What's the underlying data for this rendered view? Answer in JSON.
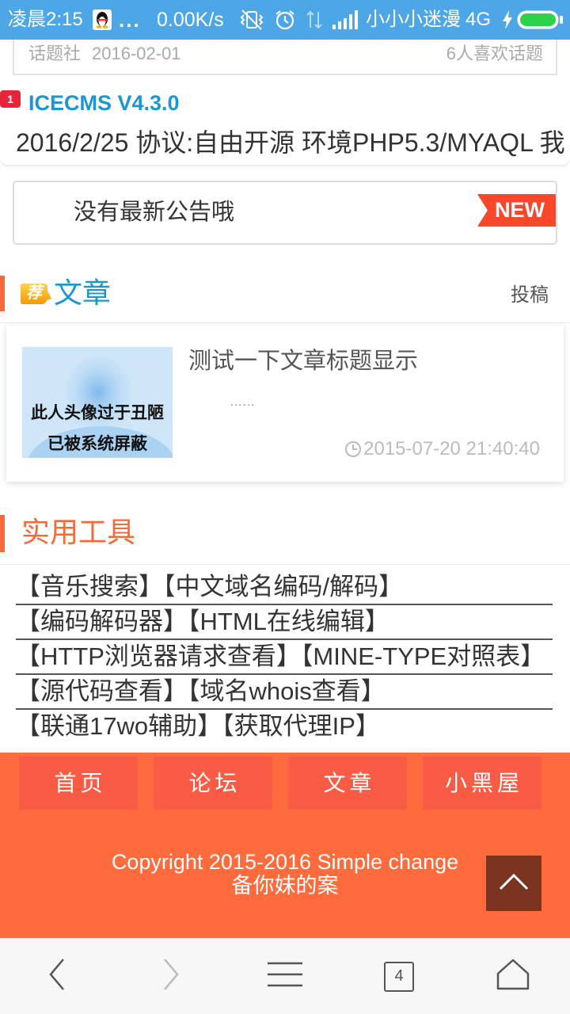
{
  "status_bar": {
    "time": "凌晨2:15",
    "more": "...",
    "speed": "0.00K/s",
    "carrier": "小小小迷漫",
    "network": "4G",
    "icons": [
      "qq-icon",
      "vibrate-off-icon",
      "alarm-icon",
      "data-activity-icon",
      "signal-icon",
      "charging-icon",
      "battery-icon"
    ]
  },
  "topic_card": {
    "source": "话题社",
    "date": "2016-02-01",
    "likes": "6人喜欢话题"
  },
  "featured": {
    "rank": "1",
    "title": "ICECMS V4.3.0",
    "summary": "2016/2/25 协议:自由开源 环境PHP5.3/MYAQL 我"
  },
  "notice": {
    "text": "没有最新公告哦",
    "badge": "NEW"
  },
  "articles": {
    "icon_text": "荐",
    "title": "文章",
    "action": "投稿",
    "items": [
      {
        "thumb_text": [
          "此人头像过于丑陋",
          "已被系统屏蔽"
        ],
        "title": "测试一下文章标题显示",
        "excerpt": "……",
        "time_icon": "clock-icon",
        "time": "2015-07-20 21:40:40"
      }
    ]
  },
  "tools": {
    "title": "实用工具",
    "rows": [
      [
        "【音乐搜索】",
        "【中文域名编码/解码】"
      ],
      [
        "【编码解码器】",
        "【HTML在线编辑】"
      ],
      [
        "【HTTP浏览器请求查看】",
        "【MINE-TYPE对照表】"
      ],
      [
        "【源代码查看】",
        "【域名whois查看】"
      ],
      [
        "【联通17wo辅助】",
        "【获取代理IP】"
      ]
    ]
  },
  "footer": {
    "nav": [
      "首页",
      "论坛",
      "文章",
      "小黑屋"
    ],
    "copyright": "Copyright 2015-2016 Simple change",
    "icp": "备你妹的案",
    "back_to_top_icon": "chevron-up-icon"
  },
  "browser_bar": {
    "icons": [
      "back-icon",
      "forward-icon",
      "menu-icon",
      "tabs-icon",
      "home-icon"
    ],
    "tab_count": "4"
  },
  "colors": {
    "status_bar": "#4da6e6",
    "accent": "#f36a3c",
    "link_blue": "#1c96d2",
    "footer": "#fe6b3d",
    "footer_button": "#f95b45",
    "back_to_top": "#7b3420",
    "new_badge": "#f8472b",
    "rank_badge": "#e8243a",
    "battery": "#2ed14a"
  }
}
